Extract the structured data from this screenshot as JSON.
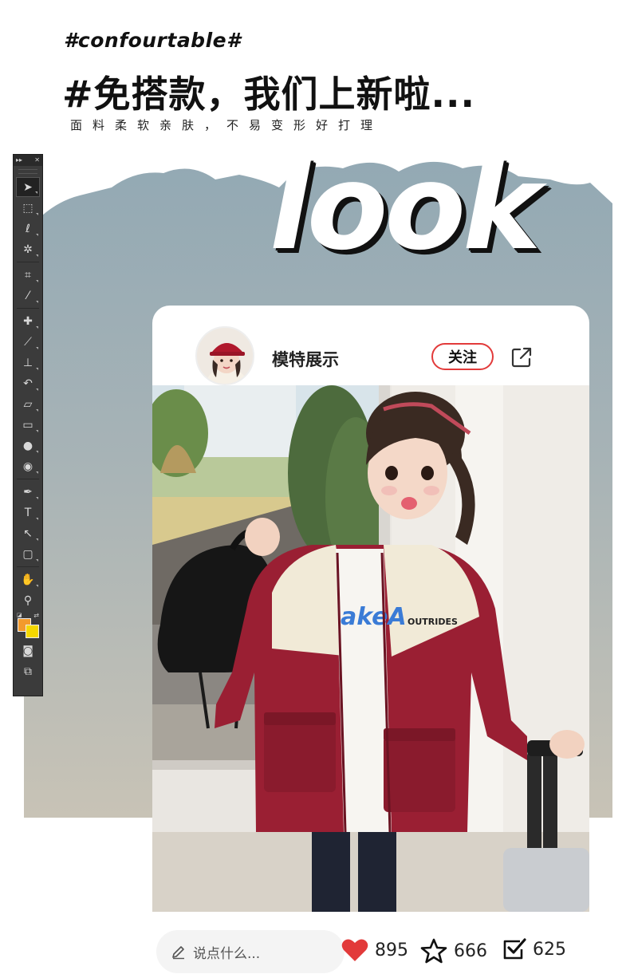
{
  "header": {
    "tag": "#confourtable#",
    "headline": "#免搭款，我们上新啦...",
    "subline": "面料柔软亲肤，不易变形好打理"
  },
  "hero": {
    "word": "look"
  },
  "toolbox": {
    "tools": [
      "move-tool",
      "marquee-tool",
      "lasso-tool",
      "magic-wand-tool",
      "crop-tool",
      "eyedropper-tool",
      "healing-brush-tool",
      "brush-tool",
      "clone-stamp-tool",
      "history-brush-tool",
      "eraser-tool",
      "gradient-tool",
      "blur-tool",
      "dodge-tool",
      "pen-tool",
      "type-tool",
      "path-selection-tool",
      "shape-tool",
      "hand-tool",
      "zoom-tool"
    ],
    "foreground_color": "#f39a2c",
    "background_color": "#f5d800"
  },
  "card": {
    "username": "模特展示",
    "follow_label": "关注",
    "accent": "#e23a3a"
  },
  "shirt_print": {
    "text1": "akeA",
    "text2": "OUTRIDES"
  },
  "actions": {
    "comment_placeholder": "说点什么...",
    "likes": "895",
    "favorites": "666",
    "shares": "625",
    "like_color": "#e23a3a"
  }
}
